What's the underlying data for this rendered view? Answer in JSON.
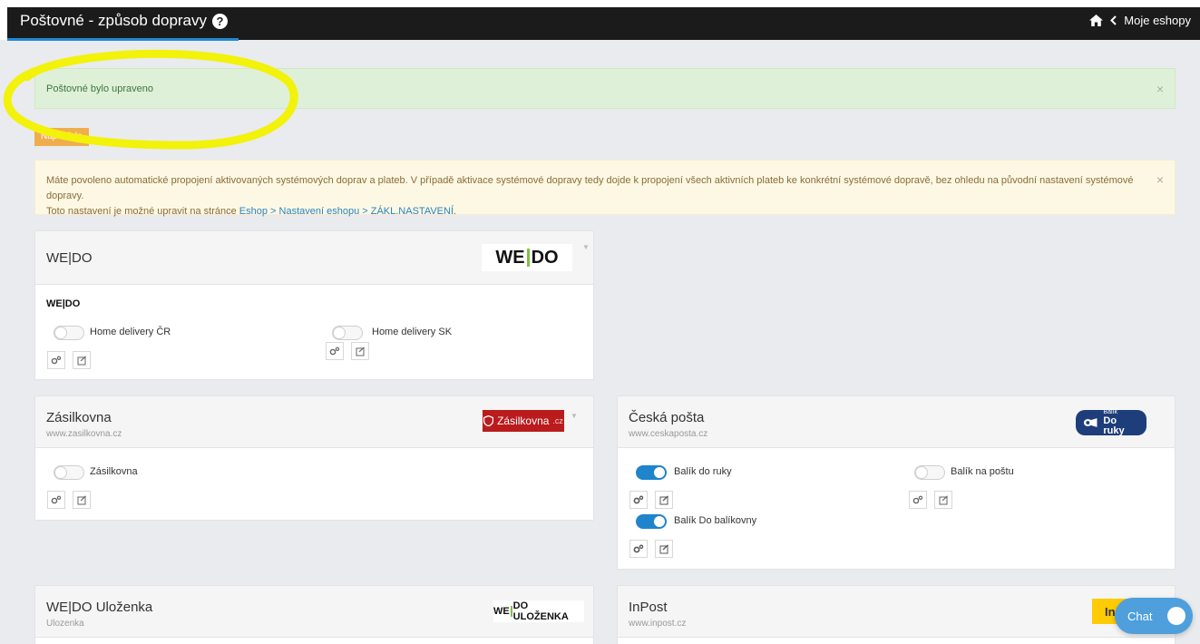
{
  "header": {
    "title": "Poštovné - způsob dopravy",
    "back_link": "Moje eshopy"
  },
  "alerts": {
    "success": "Poštovné bylo upraveno",
    "close": "×",
    "warning_line1": "Máte povoleno automatické propojení aktivovaných systémových doprav a plateb. V případě aktivace systémové dopravy tedy dojde k propojení všech aktivních plateb ke konkrétní systémové dopravě, bez ohledu na původní nastavení systémové dopravy.",
    "warning_line2_prefix": "Toto nastavení je možné upravit na stránce ",
    "warning_link": "Eshop > Nastavení eshopu > ZÁKL.NASTAVENÍ",
    "warning_line2_suffix": "."
  },
  "help_button": "Nápověda",
  "carriers": {
    "wedo": {
      "title": "WE|DO",
      "brand": "WE|DO",
      "logo_left": "WE",
      "logo_right": "DO",
      "services": [
        {
          "label": "Home delivery ČR",
          "enabled": false
        },
        {
          "label": "Home delivery SK",
          "enabled": false
        }
      ]
    },
    "zasilkovna": {
      "title": "Zásilkovna",
      "url": "www.zasilkovna.cz",
      "logo": "Zásilkovna",
      "logo_suffix": ".cz",
      "services": [
        {
          "label": "Zásilkovna",
          "enabled": false
        }
      ]
    },
    "ceskaposta": {
      "title": "Česká pošta",
      "url": "www.ceskaposta.cz",
      "logo_line1": "Balík",
      "logo_line2": "Do ruky",
      "services": [
        {
          "label": "Balík do ruky",
          "enabled": true
        },
        {
          "label": "Balík na poštu",
          "enabled": false
        },
        {
          "label": "Balík Do balíkovny",
          "enabled": true
        }
      ]
    },
    "ulozenka": {
      "title": "WE|DO Uloženka",
      "url": "Ulozenka",
      "logo_left": "WE",
      "logo_right": "DO ULOŽENKA"
    },
    "inpost": {
      "title": "InPost",
      "url": "www.inpost.cz",
      "logo": "In"
    }
  },
  "chat": {
    "label": "Chat"
  },
  "colors": {
    "accent": "#1f84cc",
    "highlight": "#f2f20a",
    "warning_button": "#f0ad4e"
  }
}
